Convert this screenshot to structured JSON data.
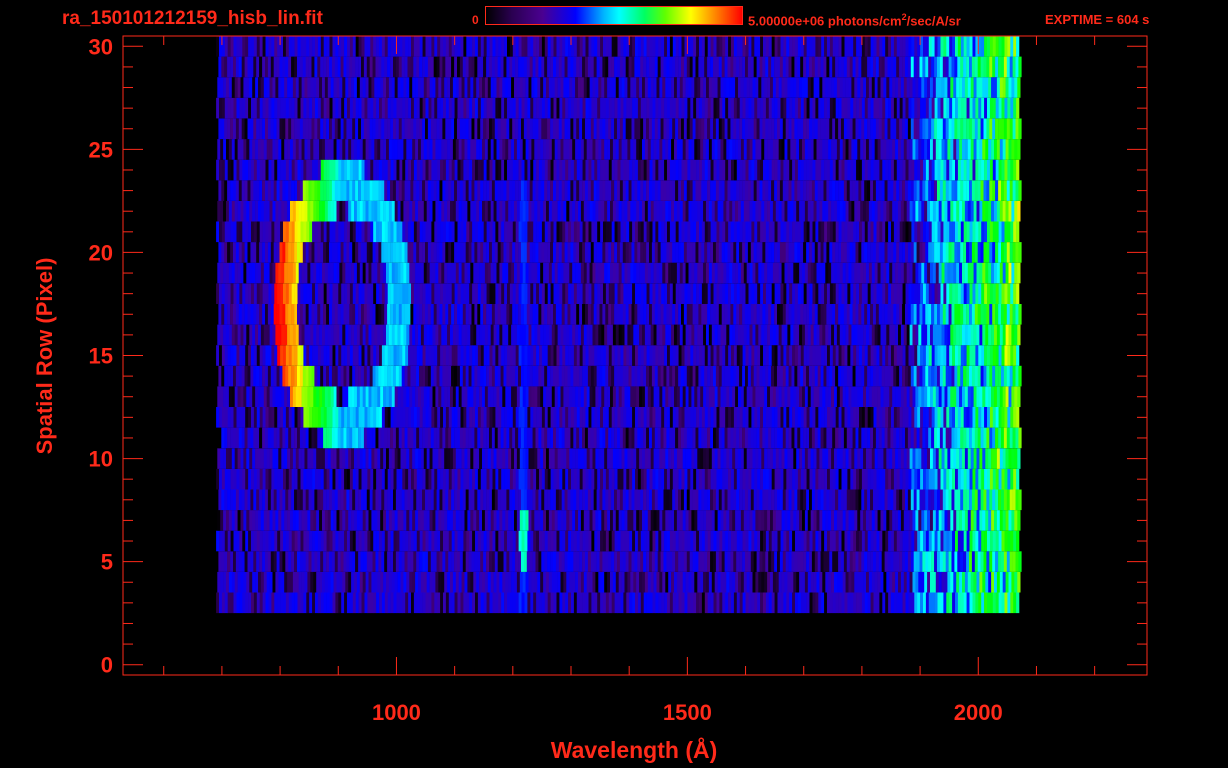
{
  "header": {
    "filename": "ra_150101212159_hisb_lin.fit",
    "colorbar_min": "0",
    "colorbar_max_prefix": "5.00000e+06 photons/cm",
    "colorbar_max_exp": "2",
    "colorbar_max_suffix": "/sec/A/sr",
    "exptime": "EXPTIME = 604 s"
  },
  "colors": {
    "axis": "#ff2a1a",
    "background": "#000000"
  },
  "chart_data": {
    "type": "heatmap",
    "title": "ra_150101212159_hisb_lin.fit",
    "xlabel": "Wavelength (Å)",
    "ylabel": "Spatial Row (Pixel)",
    "xlim": [
      530,
      2290
    ],
    "ylim": [
      -0.5,
      30.5
    ],
    "xticks": [
      1000,
      1500,
      2000
    ],
    "xtick_labels": [
      "1000",
      "1500",
      "2000"
    ],
    "yticks": [
      0,
      5,
      10,
      15,
      20,
      25,
      30
    ],
    "ytick_labels": [
      "0",
      "5",
      "10",
      "15",
      "20",
      "25",
      "30"
    ],
    "colorscale": [
      "#000000",
      "#4a0090",
      "#0000ff",
      "#00ffff",
      "#00ff00",
      "#ffff00",
      "#ff0000"
    ],
    "colorbar_range": [
      0,
      5000000
    ],
    "colorbar_units": "photons/cm^2/sec/A/sr",
    "data_extent": {
      "x": [
        690,
        2070
      ],
      "rows": [
        3,
        30
      ]
    },
    "features": [
      {
        "name": "arc emission",
        "x_range": [
          780,
          1020
        ],
        "rows": [
          11,
          24
        ],
        "peak_intensity_fraction": 1.0
      },
      {
        "name": "Lyman-alpha line",
        "x": 1216,
        "rows": [
          3,
          23
        ],
        "peak_row": 6,
        "peak_intensity_fraction": 0.55
      },
      {
        "name": "long-wavelength continuum",
        "x_range": [
          1900,
          2070
        ],
        "rows": [
          1,
          30
        ],
        "peak_intensity_fraction": 0.7
      }
    ]
  }
}
